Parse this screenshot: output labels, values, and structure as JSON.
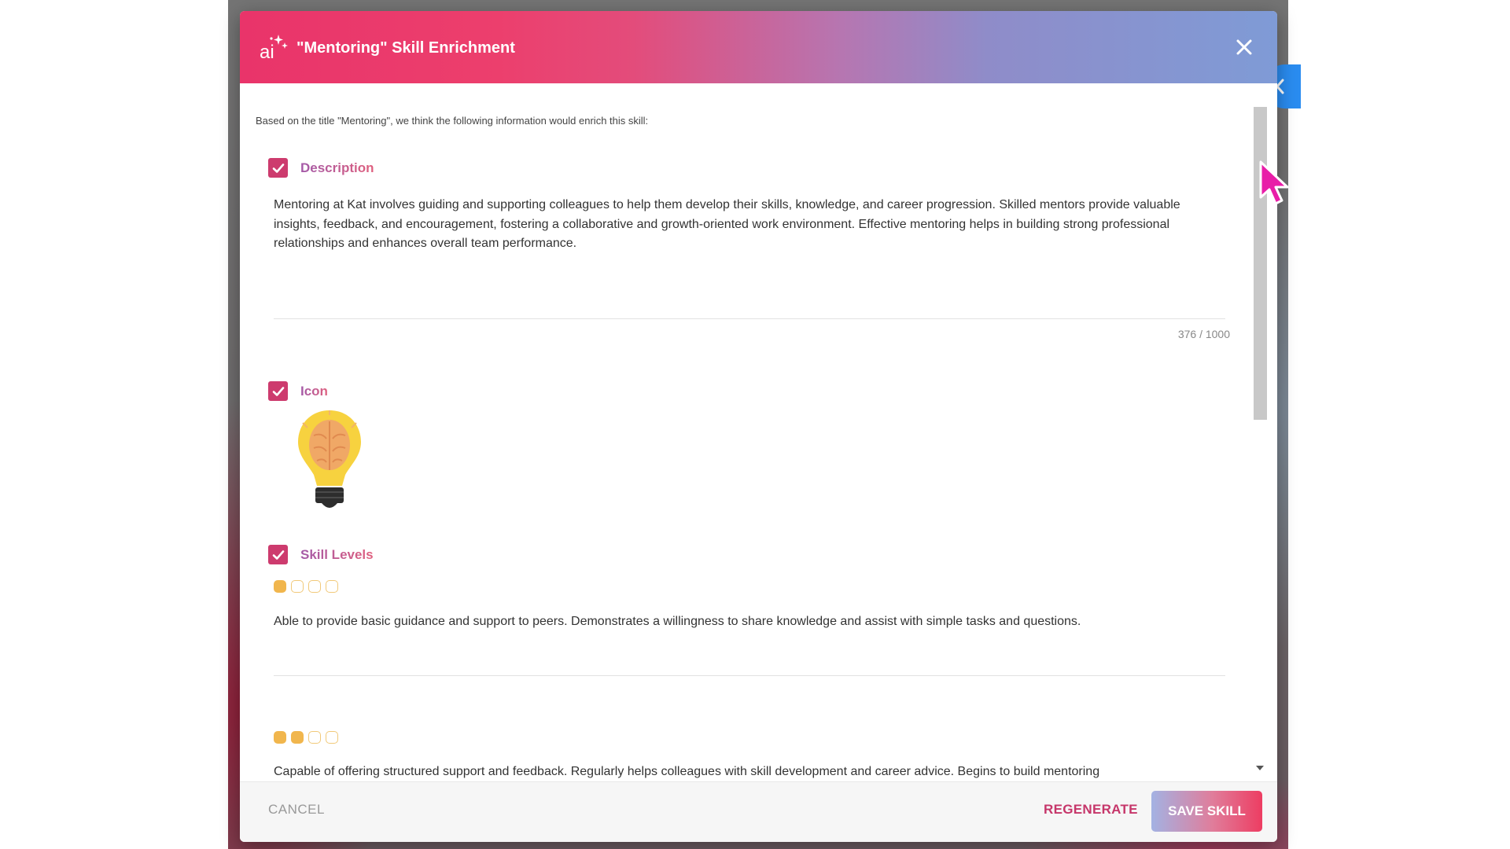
{
  "dialog": {
    "title": "\"Mentoring\" Skill Enrichment",
    "intro": "Based on the title \"Mentoring\", we think the following information would enrich this skill:"
  },
  "description": {
    "label": "Description",
    "checked": true,
    "text": "Mentoring at Kat involves guiding and supporting colleagues to help them develop their skills, knowledge, and career progression. Skilled mentors provide valuable insights, feedback, and encouragement, fostering a collaborative and growth-oriented work environment. Effective mentoring helps in building strong professional relationships and enhances overall team performance.",
    "counter": "376 / 1000"
  },
  "icon_section": {
    "label": "Icon",
    "checked": true,
    "icon_name": "lightbulb-brain-icon"
  },
  "skill_levels": {
    "label": "Skill Levels",
    "checked": true,
    "max_level": 4,
    "levels": [
      {
        "level": 1,
        "text": "Able to provide basic guidance and support to peers. Demonstrates a willingness to share knowledge and assist with simple tasks and questions."
      },
      {
        "level": 2,
        "text": "Capable of offering structured support and feedback. Regularly helps colleagues with skill development and career advice. Begins to build mentoring"
      }
    ]
  },
  "footer": {
    "cancel_label": "CANCEL",
    "regenerate_label": "REGENERATE",
    "save_label": "SAVE SKILL"
  },
  "colors": {
    "accent": "#cd3b6e",
    "level_on": "#f1b64d",
    "level_off": "#f1c979",
    "side_toggle": "#2a8cf0",
    "cursor": "#e81ea8"
  }
}
